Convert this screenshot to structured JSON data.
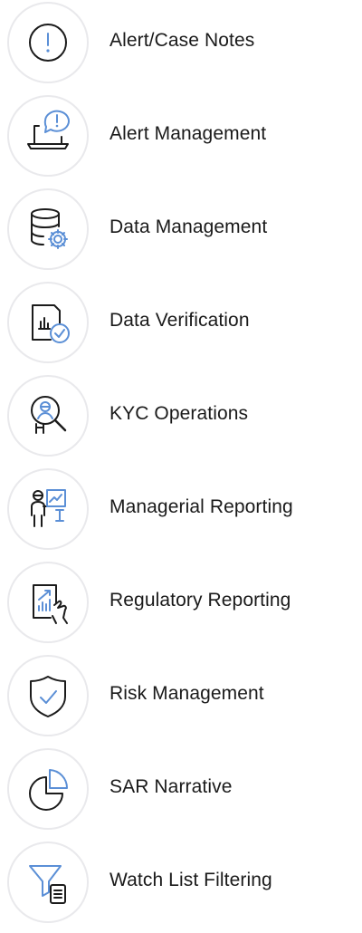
{
  "colors": {
    "outline": "#1b1b1b",
    "accent": "#5b8fd6",
    "circle_border": "#e9e9ec",
    "text": "#1a1a1a"
  },
  "items": [
    {
      "label": "Alert/Case Notes",
      "icon": "exclamation-circle-icon"
    },
    {
      "label": "Alert Management",
      "icon": "laptop-alert-icon"
    },
    {
      "label": "Data Management",
      "icon": "database-gear-icon"
    },
    {
      "label": "Data Verification",
      "icon": "document-chart-check-icon"
    },
    {
      "label": "KYC Operations",
      "icon": "magnifier-person-icon"
    },
    {
      "label": "Managerial Reporting",
      "icon": "presenter-chart-icon"
    },
    {
      "label": "Regulatory Reporting",
      "icon": "tablet-chart-hand-icon"
    },
    {
      "label": "Risk Management",
      "icon": "shield-check-icon"
    },
    {
      "label": "SAR Narrative",
      "icon": "pie-chart-icon"
    },
    {
      "label": "Watch List Filtering",
      "icon": "filter-list-icon"
    }
  ]
}
